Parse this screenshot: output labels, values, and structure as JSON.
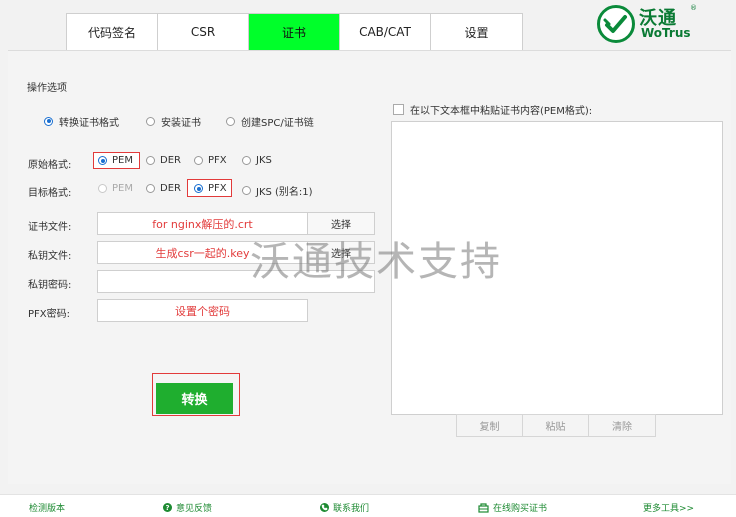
{
  "tabs": [
    {
      "label": "代码签名",
      "active": false
    },
    {
      "label": "CSR",
      "active": false
    },
    {
      "label": "证书",
      "active": true
    },
    {
      "label": "CAB/CAT",
      "active": false
    },
    {
      "label": "设置",
      "active": false
    }
  ],
  "logo": {
    "cn": "沃通",
    "en": "WoTrus",
    "reg": "®"
  },
  "section_title": "操作选项",
  "operations": [
    {
      "label": "转换证书格式",
      "selected": true
    },
    {
      "label": "安装证书",
      "selected": false
    },
    {
      "label": "创建SPC/证书链",
      "selected": false
    }
  ],
  "source_format": {
    "label": "原始格式:",
    "options": [
      {
        "label": "PEM",
        "selected": true
      },
      {
        "label": "DER",
        "selected": false
      },
      {
        "label": "PFX",
        "selected": false
      },
      {
        "label": "JKS",
        "selected": false
      }
    ]
  },
  "target_format": {
    "label": "目标格式:",
    "options": [
      {
        "label": "PEM",
        "selected": false,
        "disabled": true
      },
      {
        "label": "DER",
        "selected": false
      },
      {
        "label": "PFX",
        "selected": true
      },
      {
        "label": "JKS (别名:1)",
        "selected": false
      }
    ]
  },
  "fields": {
    "cert_file": {
      "label": "证书文件:",
      "value": "for nginx解压的.crt",
      "button": "选择"
    },
    "key_file": {
      "label": "私钥文件:",
      "value": "生成csr一起的.key",
      "button": "选择"
    },
    "key_password": {
      "label": "私钥密码:",
      "value": ""
    },
    "pfx_password": {
      "label": "PFX密码:",
      "value": "设置个密码"
    }
  },
  "convert_button": "转换",
  "paste": {
    "checkbox_label": "在以下文本框中粘贴证书内容(PEM格式):",
    "checked": false,
    "content": "",
    "buttons": [
      "复制",
      "粘贴",
      "清除"
    ]
  },
  "watermark": "沃通技术支持",
  "footer": {
    "check_version": "检测版本",
    "feedback": "意见反馈",
    "contact": "联系我们",
    "buy_online": "在线购买证书",
    "more_tools": "更多工具>>"
  },
  "colors": {
    "active_tab": "#00ff2a",
    "brand_green": "#0a7a34",
    "convert_button": "#1fae2f",
    "annotation_red": "#e23a3a"
  }
}
